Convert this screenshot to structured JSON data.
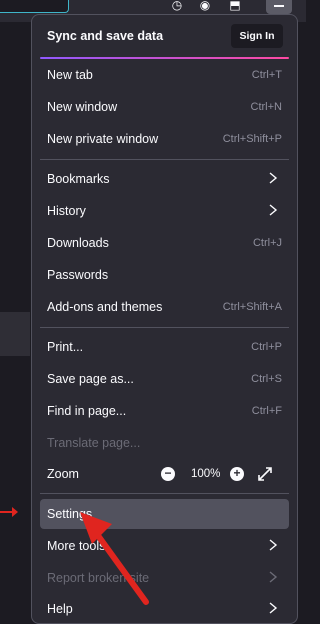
{
  "menu": {
    "sync": {
      "label": "Sync and save data",
      "signin": "Sign In"
    },
    "groups": [
      [
        {
          "label": "New tab",
          "shortcut": "Ctrl+T"
        },
        {
          "label": "New window",
          "shortcut": "Ctrl+N"
        },
        {
          "label": "New private window",
          "shortcut": "Ctrl+Shift+P"
        }
      ],
      [
        {
          "label": "Bookmarks",
          "submenu": true
        },
        {
          "label": "History",
          "submenu": true
        },
        {
          "label": "Downloads",
          "shortcut": "Ctrl+J"
        },
        {
          "label": "Passwords"
        },
        {
          "label": "Add-ons and themes",
          "shortcut": "Ctrl+Shift+A"
        }
      ],
      [
        {
          "label": "Print...",
          "shortcut": "Ctrl+P"
        },
        {
          "label": "Save page as...",
          "shortcut": "Ctrl+S"
        },
        {
          "label": "Find in page...",
          "shortcut": "Ctrl+F"
        },
        {
          "label": "Translate page...",
          "disabled": true
        }
      ]
    ],
    "zoom": {
      "label": "Zoom",
      "minus": "−",
      "value": "100%",
      "plus": "+"
    },
    "bottom": [
      {
        "label": "Settings",
        "highlighted": true
      },
      {
        "label": "More tools",
        "submenu": true
      },
      {
        "label": "Report broken site",
        "submenu": true,
        "disabled": true
      },
      {
        "label": "Help",
        "submenu": true
      }
    ]
  },
  "colors": {
    "panel": "#2b2a33",
    "separator": "#52525e",
    "annotation": "#e0251f"
  }
}
